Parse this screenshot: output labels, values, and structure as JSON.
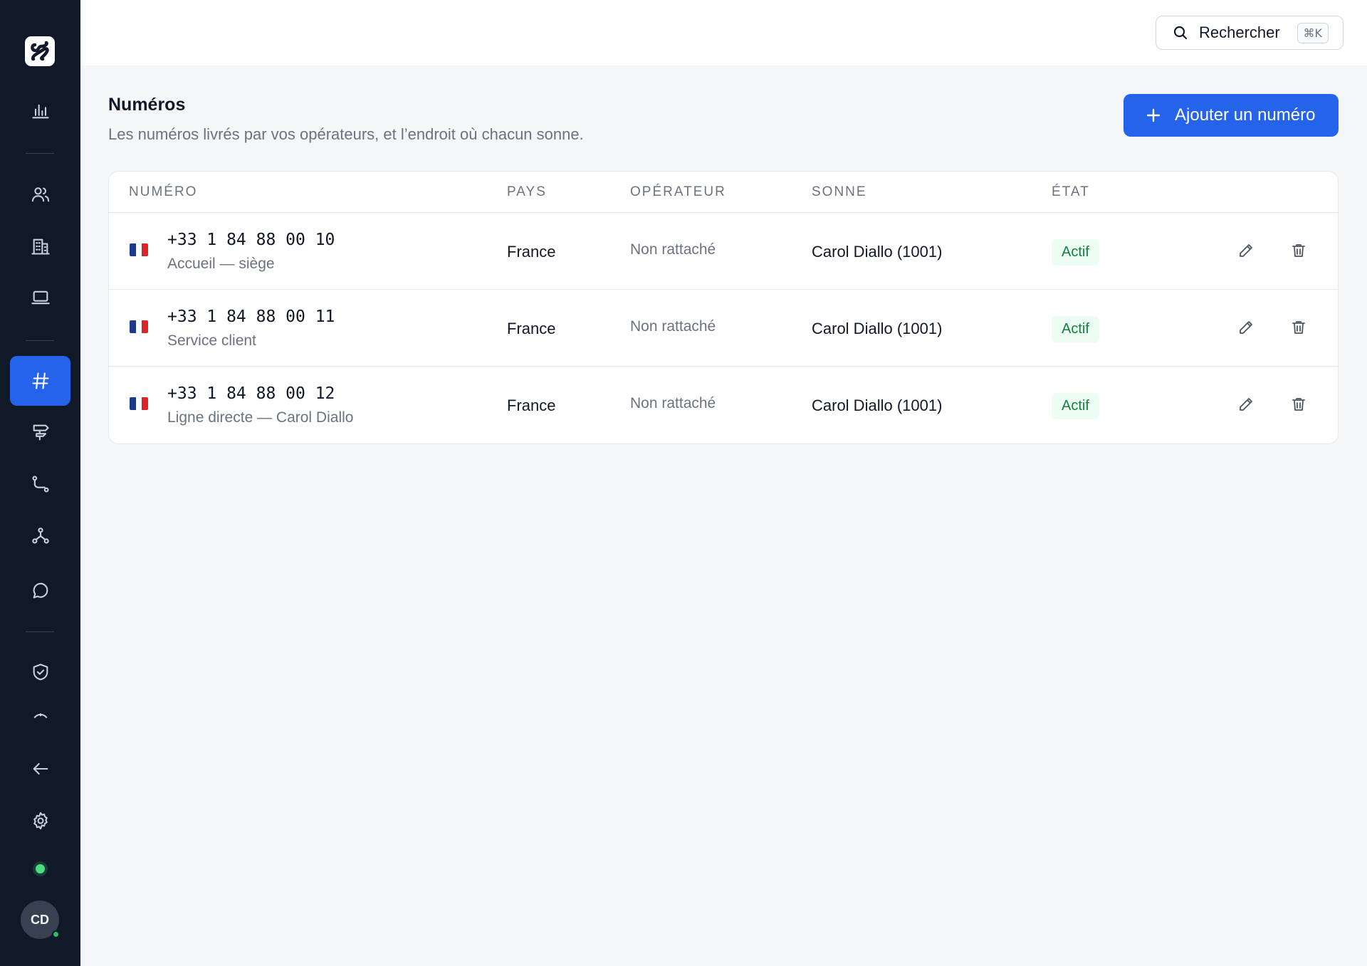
{
  "sidebar": {
    "logo_icon": "app-logo",
    "nav": [
      {
        "icon": "chart-icon",
        "active": false
      },
      {
        "icon": "users-icon",
        "active": false
      },
      {
        "icon": "building-icon",
        "active": false
      },
      {
        "icon": "laptop-icon",
        "active": false
      },
      {
        "icon": "hash-icon",
        "active": true
      },
      {
        "icon": "signpost-icon",
        "active": false
      },
      {
        "icon": "route-icon",
        "active": false
      },
      {
        "icon": "network-icon",
        "active": false
      },
      {
        "icon": "chat-icon",
        "active": false
      },
      {
        "icon": "shield-check-icon",
        "active": false
      },
      {
        "icon": "arc-icon",
        "active": false
      },
      {
        "icon": "arrow-left-icon",
        "active": false
      },
      {
        "icon": "gear-icon",
        "active": false
      }
    ],
    "avatar_initials": "CD",
    "accent_color": "#2563eb",
    "status_color": "#4ade80"
  },
  "topbar": {
    "search_label": "Rechercher",
    "search_shortcut": "⌘K"
  },
  "header": {
    "title": "Numéros",
    "subtitle": "Les numéros livrés par vos opérateurs, et l’endroit où chacun sonne.",
    "add_button_label": "Ajouter un numéro"
  },
  "table": {
    "columns": {
      "number": "NUMÉRO",
      "country": "PAYS",
      "operator": "OPÉRATEUR",
      "rings": "SONNE",
      "state": "ÉTAT"
    },
    "rows": [
      {
        "flag": "FR",
        "number": "+33 1 84 88 00 10",
        "label": "Accueil — siège",
        "country": "France",
        "operator": "Non rattaché",
        "rings": "Carol Diallo (1001)",
        "state": "Actif"
      },
      {
        "flag": "FR",
        "number": "+33 1 84 88 00 11",
        "label": "Service client",
        "country": "France",
        "operator": "Non rattaché",
        "rings": "Carol Diallo (1001)",
        "state": "Actif"
      },
      {
        "flag": "FR",
        "number": "+33 1 84 88 00 12",
        "label": "Ligne directe — Carol Diallo",
        "country": "France",
        "operator": "Non rattaché",
        "rings": "Carol Diallo (1001)",
        "state": "Actif"
      }
    ]
  }
}
